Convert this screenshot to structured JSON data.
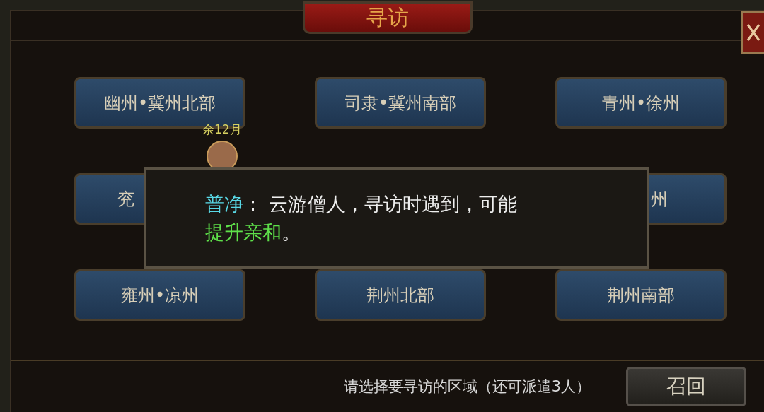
{
  "window": {
    "title": "寻访"
  },
  "regions": [
    {
      "label": "幽州•冀州北部",
      "kind": "full"
    },
    {
      "label": "司隶•冀州南部",
      "kind": "full"
    },
    {
      "label": "青州•徐州",
      "kind": "full"
    },
    {
      "label": "兖",
      "kind": "leftpart"
    },
    {
      "kind": "covered"
    },
    {
      "label": "州",
      "kind": "rightpart"
    },
    {
      "label": "雍州•凉州",
      "kind": "full"
    },
    {
      "label": "荆州北部",
      "kind": "full"
    },
    {
      "label": "荆州南部",
      "kind": "full"
    }
  ],
  "visitor": {
    "remaining": "余12月"
  },
  "tooltip": {
    "name": "普净",
    "separator": "：",
    "text": "云游僧人，寻访时遇到，可能",
    "highlight": "提升亲和",
    "end": "。"
  },
  "footer": {
    "hint": "请选择要寻访的区域（还可派遣3人）",
    "recall_button": "召回"
  }
}
